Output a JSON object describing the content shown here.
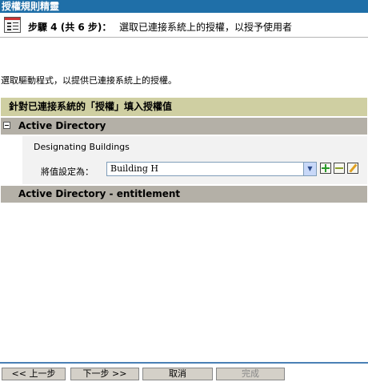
{
  "window": {
    "title": "授權規則精靈"
  },
  "step": {
    "icon": "wizard-step-icon",
    "label": "步驟 4 (共 6 步)：",
    "description": "選取已連接系統上的授權，以授予使用者"
  },
  "instructions": "選取驅動程式，以提供已連接系統上的授權。",
  "panel": {
    "header": "針對已連接系統的「授權」填入授權值",
    "sections": [
      {
        "name": "Active Directory",
        "expanded": true,
        "collapse_icon": "collapse-minus-icon",
        "entitlement": "Designating Buildings",
        "value_label": "將值設定為：",
        "selected_value": "Building H",
        "action_icons": [
          "add-icon",
          "remove-icon",
          "edit-icon"
        ]
      },
      {
        "name": "Active Directory - entitlement",
        "expanded": false
      }
    ]
  },
  "buttons": {
    "back": "<< 上一步",
    "next": "下一步 >>",
    "cancel": "取消",
    "finish": "完成"
  },
  "colors": {
    "title_bar": "#1f6fa8",
    "panel_header": "#cfcfa2",
    "section_header": "#b4b0a7",
    "bottom_rule": "#4a80b5",
    "button_face": "#d4d0c8"
  }
}
